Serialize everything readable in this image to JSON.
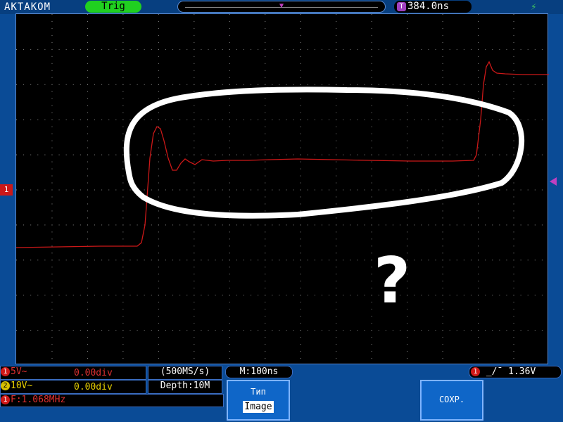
{
  "header": {
    "brand": "AKTAKOM",
    "trig_status": "Trig",
    "trigger_delay": "384.0ns",
    "trigger_badge": "T"
  },
  "screen": {
    "ch1_marker": "1",
    "t_marker": "T",
    "annotation_question": "?"
  },
  "status": {
    "ch1": {
      "badge": "1",
      "scale": "5V~",
      "offset": "0.00div"
    },
    "ch2": {
      "badge": "2",
      "scale": "10V~",
      "offset": "0.00div"
    },
    "frequency": {
      "badge": "1",
      "text": "F:1.068MHz"
    },
    "sample_rate": "(500MS/s)",
    "depth": "Depth:10M",
    "timebase": "M:100ns",
    "trigger": {
      "badge": "1",
      "level": "1.36V"
    }
  },
  "softkeys": {
    "type_title": "Тип",
    "type_value": "Image",
    "save_label": "СОХР."
  },
  "colors": {
    "ch1": "#cc1818",
    "ch2": "#d8c000",
    "trigger": "#c040c0",
    "annotation": "#ffffff"
  }
}
